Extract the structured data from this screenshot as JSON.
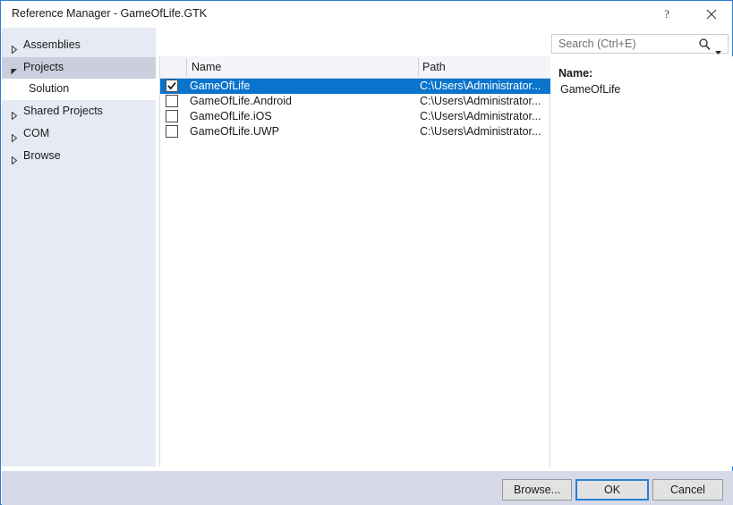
{
  "window": {
    "title": "Reference Manager - GameOfLife.GTK",
    "help_icon": "question-mark-icon",
    "close_icon": "close-icon",
    "accent_color": "#2a7fd4"
  },
  "sidebar": {
    "items": [
      {
        "label": "Assemblies",
        "level": 0,
        "state": "collapsed",
        "expander": "chevron-right-icon"
      },
      {
        "label": "Projects",
        "level": 0,
        "state": "expanded",
        "expander": "chevron-down-icon"
      },
      {
        "label": "Solution",
        "level": 1,
        "state": "active",
        "expander": ""
      },
      {
        "label": "Shared Projects",
        "level": 0,
        "state": "collapsed",
        "expander": "chevron-right-icon"
      },
      {
        "label": "COM",
        "level": 0,
        "state": "collapsed",
        "expander": "chevron-right-icon"
      },
      {
        "label": "Browse",
        "level": 0,
        "state": "collapsed",
        "expander": "chevron-right-icon"
      }
    ]
  },
  "search": {
    "placeholder": "Search (Ctrl+E)",
    "value": "",
    "icon": "magnifier-icon",
    "dropdown_icon": "chevron-down-icon"
  },
  "list": {
    "columns": [
      {
        "key": "check",
        "label": ""
      },
      {
        "key": "name",
        "label": "Name"
      },
      {
        "key": "path",
        "label": "Path"
      }
    ],
    "rows": [
      {
        "checked": true,
        "selected": true,
        "name": "GameOfLife",
        "path": "C:\\Users\\Administrator..."
      },
      {
        "checked": false,
        "selected": false,
        "name": "GameOfLife.Android",
        "path": "C:\\Users\\Administrator..."
      },
      {
        "checked": false,
        "selected": false,
        "name": "GameOfLife.iOS",
        "path": "C:\\Users\\Administrator..."
      },
      {
        "checked": false,
        "selected": false,
        "name": "GameOfLife.UWP",
        "path": "C:\\Users\\Administrator..."
      }
    ]
  },
  "details": {
    "name_label": "Name:",
    "name_value": "GameOfLife"
  },
  "footer": {
    "browse_label": "Browse...",
    "ok_label": "OK",
    "cancel_label": "Cancel"
  }
}
